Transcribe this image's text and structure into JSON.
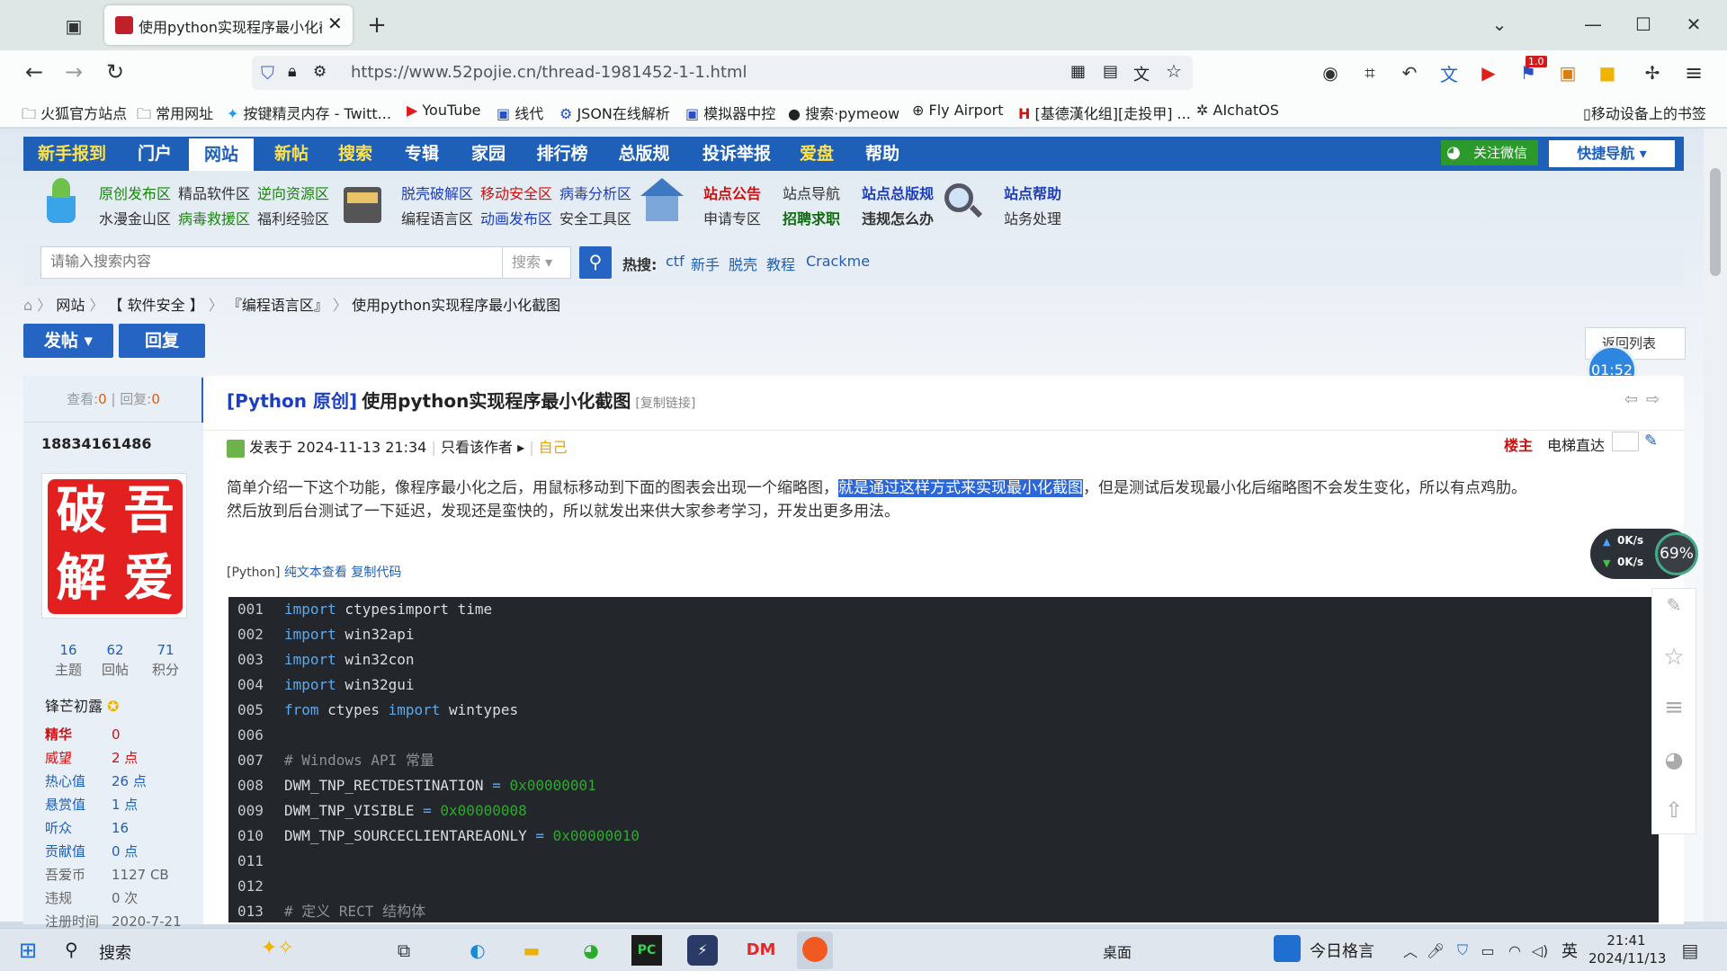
{
  "browser": {
    "tab_title": "使用python实现程序最小化截图",
    "url": "https://www.52pojie.cn/thread-1981452-1-1.html",
    "bookmarks": [
      "火狐官方站点",
      "常用网址",
      "按键精灵内存 - Twitt...",
      "YouTube",
      "线代",
      "JSON在线解析",
      "模拟器中控",
      "搜索·pymeow",
      "Fly Airport",
      "[基德漢化组][走投甲] ...",
      "AIchatOS",
      "移动设备上的书签"
    ],
    "ext_badge": "1.0"
  },
  "nav": {
    "items": [
      "新手报到",
      "门户",
      "网站",
      "新帖",
      "搜索",
      "专辑",
      "家园",
      "排行榜",
      "总版规",
      "投诉举报",
      "爱盘",
      "帮助"
    ],
    "wechat": "关注微信",
    "quick_nav": "快捷导航 ▾"
  },
  "subnav": {
    "col1": [
      "原创发布区",
      "精品软件区",
      "逆向资源区",
      "水漫金山区",
      "病毒救援区",
      "福利经验区"
    ],
    "col2": [
      "脱壳破解区",
      "移动安全区",
      "病毒分析区",
      "编程语言区",
      "动画发布区",
      "安全工具区"
    ],
    "col3": [
      "站点公告",
      "站点导航",
      "站点总版规",
      "申请专区",
      "招聘求职",
      "违规怎么办"
    ],
    "col4": [
      "站点帮助",
      "站务处理"
    ]
  },
  "search": {
    "placeholder": "请输入搜索内容",
    "type": "搜索",
    "hot_label": "热搜:",
    "hot": [
      "ctf",
      "新手",
      "脱壳",
      "教程",
      "Crackme"
    ]
  },
  "breadcrumb": [
    "网站",
    "【 软件安全 】",
    "『编程语言区』",
    "使用python实现程序最小化截图"
  ],
  "actions": {
    "post": "发帖 ▾",
    "reply": "回复",
    "back": "返回列表"
  },
  "timer": "01:52",
  "thread": {
    "views_label": "查看:",
    "views": "0",
    "replies_label": "回复:",
    "replies": "0",
    "tag": "[Python 原创]",
    "title": "使用python实现程序最小化截图",
    "copy_link": "[复制链接]",
    "posted": "发表于 2024-11-13 21:34",
    "only_author": "只看该作者",
    "self": "自己",
    "floor": "楼主",
    "elevator": "电梯直达",
    "body_1a": "简单介绍一下这个功能，像程序最小化之后，用鼠标移动到下面的图表会出现一个缩略图，",
    "body_1b": "就是通过这样方式来实现最小化截图",
    "body_1c": "，但是测试后发现最小化后缩略图不会发生变化，所以有点鸡肋。",
    "body_2": "然后放到后台测试了一下延迟，发现还是蛮快的，所以就发出来供大家参考学习，开发出更多用法。",
    "code_lang": "[Python]",
    "view_plain": "纯文本查看",
    "copy_code": "复制代码"
  },
  "author": {
    "name": "18834161486",
    "avatar_text": [
      "破",
      "吾",
      "解",
      "爱"
    ],
    "stats": [
      {
        "v": "16",
        "l": "主题"
      },
      {
        "v": "62",
        "l": "回帖"
      },
      {
        "v": "71",
        "l": "积分"
      }
    ],
    "rank": "锋芒初露",
    "props": [
      {
        "k": "精华",
        "v": "0"
      },
      {
        "k": "威望",
        "v": "2 点"
      },
      {
        "k": "热心值",
        "v": "26 点"
      },
      {
        "k": "悬赏值",
        "v": "1 点"
      },
      {
        "k": "听众",
        "v": "16"
      },
      {
        "k": "贡献值",
        "v": "0 点"
      },
      {
        "k": "吾爱币",
        "v": "1127 CB"
      },
      {
        "k": "违规",
        "v": "0 次"
      },
      {
        "k": "注册时间",
        "v": "2020-7-21"
      }
    ]
  },
  "code": [
    {
      "n": "001",
      "t": "import ctypesimport time"
    },
    {
      "n": "002",
      "t": "import win32api"
    },
    {
      "n": "003",
      "t": "import win32con"
    },
    {
      "n": "004",
      "t": "import win32gui"
    },
    {
      "n": "005",
      "t": "from ctypes import wintypes"
    },
    {
      "n": "006",
      "t": ""
    },
    {
      "n": "007",
      "t": "# Windows API 常量"
    },
    {
      "n": "008",
      "t": "DWM_TNP_RECTDESTINATION = 0x00000001"
    },
    {
      "n": "009",
      "t": "DWM_TNP_VISIBLE = 0x00000008"
    },
    {
      "n": "010",
      "t": "DWM_TNP_SOURCECLIENTAREAONLY = 0x00000010"
    },
    {
      "n": "011",
      "t": ""
    },
    {
      "n": "012",
      "t": ""
    },
    {
      "n": "013",
      "t": "# 定义 RECT 结构体"
    }
  ],
  "netmon": {
    "up": "0K/s",
    "down": "0K/s",
    "percent": "69%"
  },
  "taskbar": {
    "search": "搜索",
    "desktop": "桌面",
    "news": "今日格言",
    "ime": "英",
    "time": "21:41",
    "date": "2024/11/13",
    "app_label": "DM"
  }
}
